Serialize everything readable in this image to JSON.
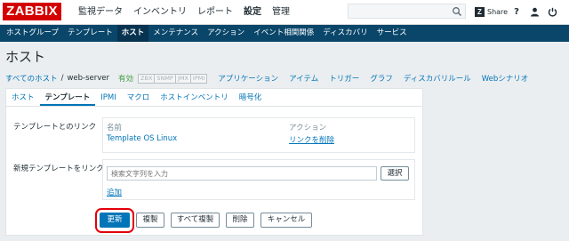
{
  "header": {
    "logo": "ZABBIX",
    "menu": [
      {
        "label": "監視データ",
        "active": false
      },
      {
        "label": "インベントリ",
        "active": false
      },
      {
        "label": "レポート",
        "active": false
      },
      {
        "label": "設定",
        "active": true
      },
      {
        "label": "管理",
        "active": false
      }
    ],
    "search_value": "",
    "share_label": "Share",
    "help_label": "?"
  },
  "subnav": [
    {
      "label": "ホストグループ",
      "active": false
    },
    {
      "label": "テンプレート",
      "active": false
    },
    {
      "label": "ホスト",
      "active": true
    },
    {
      "label": "メンテナンス",
      "active": false
    },
    {
      "label": "アクション",
      "active": false
    },
    {
      "label": "イベント相関関係",
      "active": false
    },
    {
      "label": "ディスカバリ",
      "active": false
    },
    {
      "label": "サービス",
      "active": false
    }
  ],
  "page": {
    "title": "ホスト"
  },
  "breadcrumb": {
    "all_hosts": "すべてのホスト",
    "separator": "/",
    "host": "web-server",
    "status": "有効",
    "badges": [
      "ZBX",
      "SNMP",
      "JMX",
      "IPMI"
    ],
    "links": [
      "アプリケーション",
      "アイテム",
      "トリガー",
      "グラフ",
      "ディスカバリルール",
      "Webシナリオ"
    ]
  },
  "tabs": [
    {
      "label": "ホスト",
      "active": false
    },
    {
      "label": "テンプレート",
      "active": true
    },
    {
      "label": "IPMI",
      "active": false
    },
    {
      "label": "マクロ",
      "active": false
    },
    {
      "label": "ホストインベントリ",
      "active": false
    },
    {
      "label": "暗号化",
      "active": false
    }
  ],
  "linked": {
    "label": "テンプレートとのリンク",
    "col_name": "名前",
    "col_action": "アクション",
    "template_name": "Template OS Linux",
    "unlink_label": "リンクを削除"
  },
  "new_link": {
    "label": "新規テンプレートをリンク",
    "placeholder": "検索文字列を入力",
    "select_label": "選択",
    "add_label": "追加"
  },
  "actions": {
    "update": "更新",
    "clone": "複製",
    "full_clone": "すべて複製",
    "delete": "削除",
    "cancel": "キャンセル"
  },
  "colors": {
    "logo_red": "#d40000",
    "subnav_blue": "#0a466a",
    "link_blue": "#0275b8",
    "enabled_green": "#429e47",
    "highlight_red": "#e3000b"
  }
}
